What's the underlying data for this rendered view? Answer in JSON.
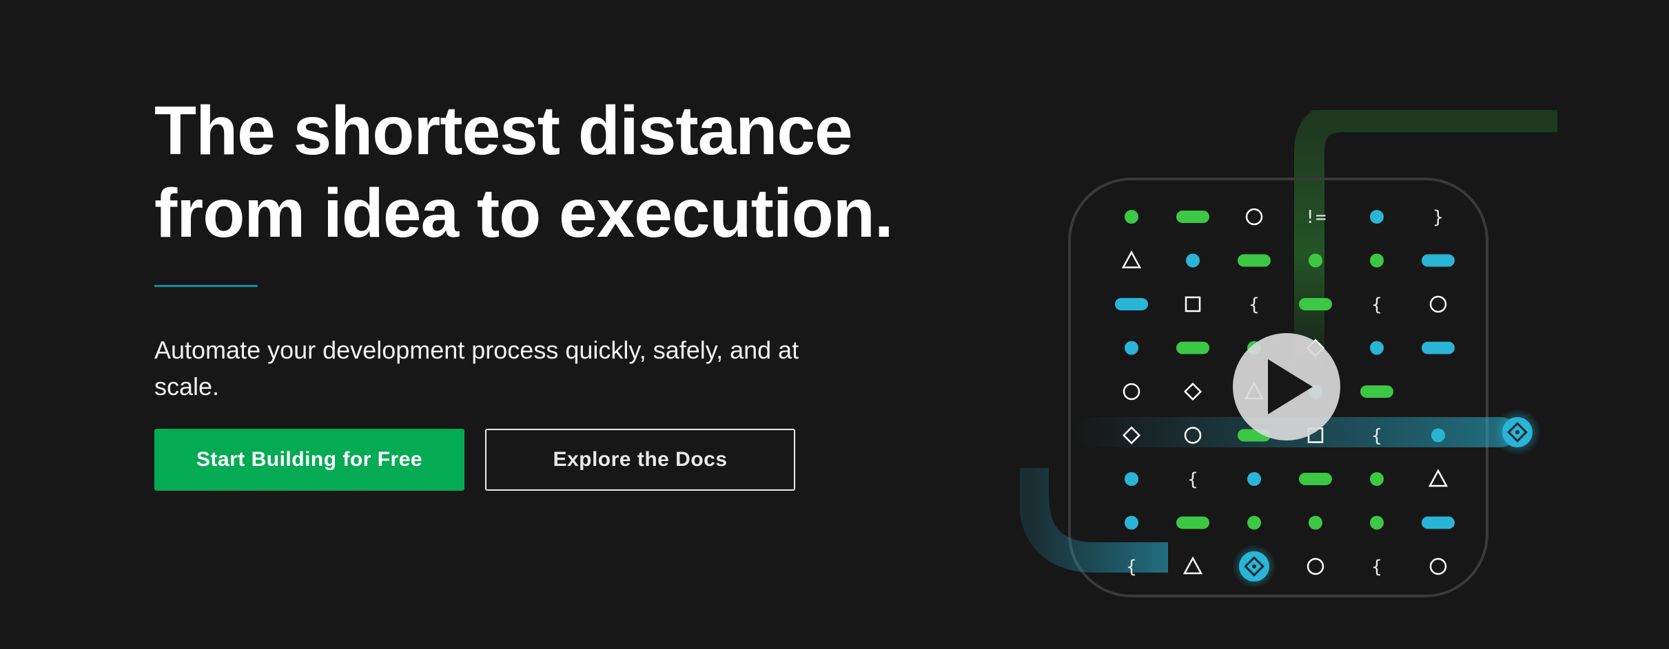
{
  "hero": {
    "headline_line1": "The shortest distance",
    "headline_line2": "from idea to execution.",
    "subhead": "Automate your development process quickly, safely, and at scale.",
    "primary_cta": "Start Building for Free",
    "secondary_cta": "Explore the Docs"
  },
  "illustration": {
    "play_icon": "play-icon",
    "colors": {
      "green": "#3cc844",
      "cyan": "#2ab5d6",
      "outline": "#ffffff",
      "accent_line": "#0f8fa8",
      "primary_button": "#05ab54"
    },
    "grid": [
      [
        "dot-g",
        "pill-g",
        "circle",
        "!=",
        "dot-c",
        "}"
      ],
      [
        "triangle",
        "dot-c",
        "pill-g",
        "dot-g",
        "dot-g",
        "pill-c"
      ],
      [
        "pill-c",
        "square",
        "{",
        "pill-g",
        "{",
        "circle"
      ],
      [
        "dot-c",
        "pill-g",
        "dot-g",
        "diamond",
        "dot-c",
        "pill-c"
      ],
      [
        "circle",
        "diamond",
        "triangle",
        "dot-c",
        "pill-g",
        ""
      ],
      [
        "diamond",
        "circle",
        "pill-g",
        "square",
        "{",
        "dot-c"
      ],
      [
        "dot-c",
        "{",
        "dot-c",
        "pill-g",
        "dot-g",
        "triangle"
      ],
      [
        "dot-c",
        "pill-g",
        "dot-g",
        "dot-g",
        "dot-g",
        "pill-c"
      ],
      [
        "{",
        "triangle",
        "node",
        "circle",
        "{",
        "circle"
      ]
    ]
  }
}
